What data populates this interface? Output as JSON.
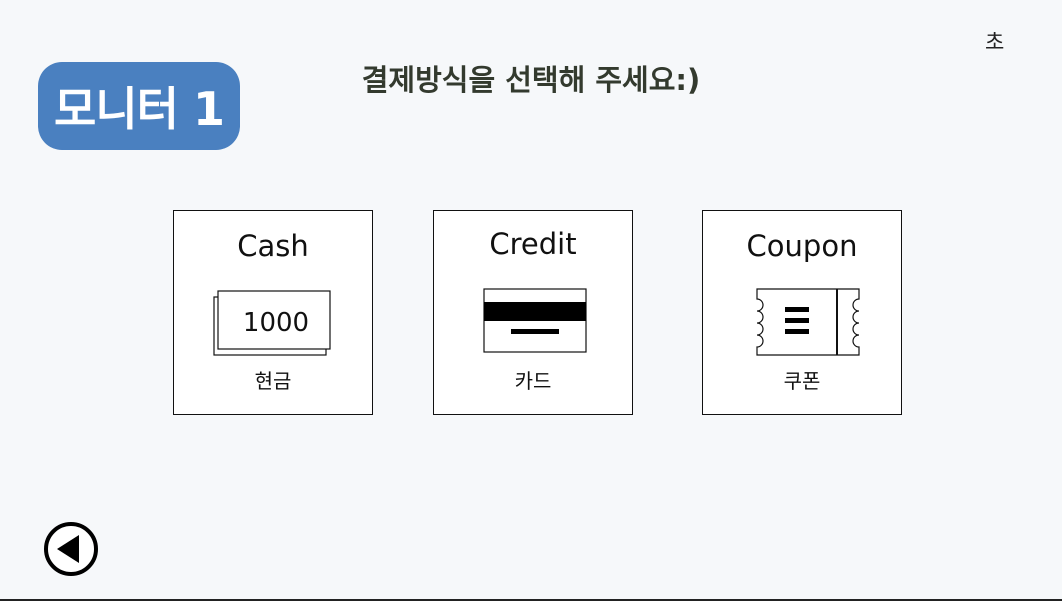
{
  "header": {
    "monitor_label": "모니터 1",
    "title": "결제방식을 선택해 주세요:)",
    "timer_label": "초"
  },
  "payment_options": [
    {
      "title": "Cash",
      "subtitle": "현금",
      "icon": "cash-icon",
      "icon_text": "1000"
    },
    {
      "title": "Credit",
      "subtitle": "카드",
      "icon": "credit-card-icon"
    },
    {
      "title": "Coupon",
      "subtitle": "쿠폰",
      "icon": "coupon-icon"
    }
  ],
  "footer": {
    "back_icon": "back-arrow-icon"
  }
}
